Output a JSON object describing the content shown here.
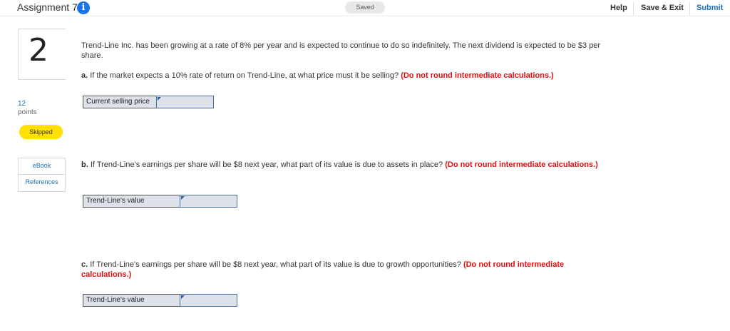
{
  "header": {
    "title": "Assignment 7",
    "info_icon": "info-icon",
    "saved": "Saved",
    "help": "Help",
    "save_exit": "Save & Exit",
    "submit": "Submit"
  },
  "sidebar": {
    "question_number": "2",
    "points_value": "12",
    "points_label": "points",
    "status": "Skipped",
    "resources": [
      "eBook",
      "References"
    ]
  },
  "question": {
    "intro": "Trend-Line Inc. has been growing at a rate of 8% per year and is expected to continue to do so indefinitely. The next dividend is expected to be $3 per share.",
    "part_a": {
      "prefix": "a.",
      "text": "If the market expects a 10% rate of return on Trend-Line, at what price must it be selling?",
      "note": "(Do not round intermediate calculations.)",
      "answer_label": "Current selling price",
      "answer_value": ""
    },
    "part_b": {
      "prefix": "b.",
      "text": "If Trend-Line's earnings per share will be $8 next year, what part of its value is due to assets in place?",
      "note": "(Do not round intermediate calculations.)",
      "answer_label": "Trend-Line's value",
      "answer_value": ""
    },
    "part_c": {
      "prefix": "c.",
      "text": "If Trend-Line's earnings per share will be $8 next year, what part of its value is due to growth opportunities?",
      "note": "(Do not round intermediate calculations.)",
      "answer_label": "Trend-Line's value",
      "answer_value": ""
    }
  },
  "colors": {
    "accent": "#1a6fb5",
    "warning_text": "#e01010",
    "skipped_badge": "#ffe000",
    "input_bg": "#dde2ea"
  }
}
